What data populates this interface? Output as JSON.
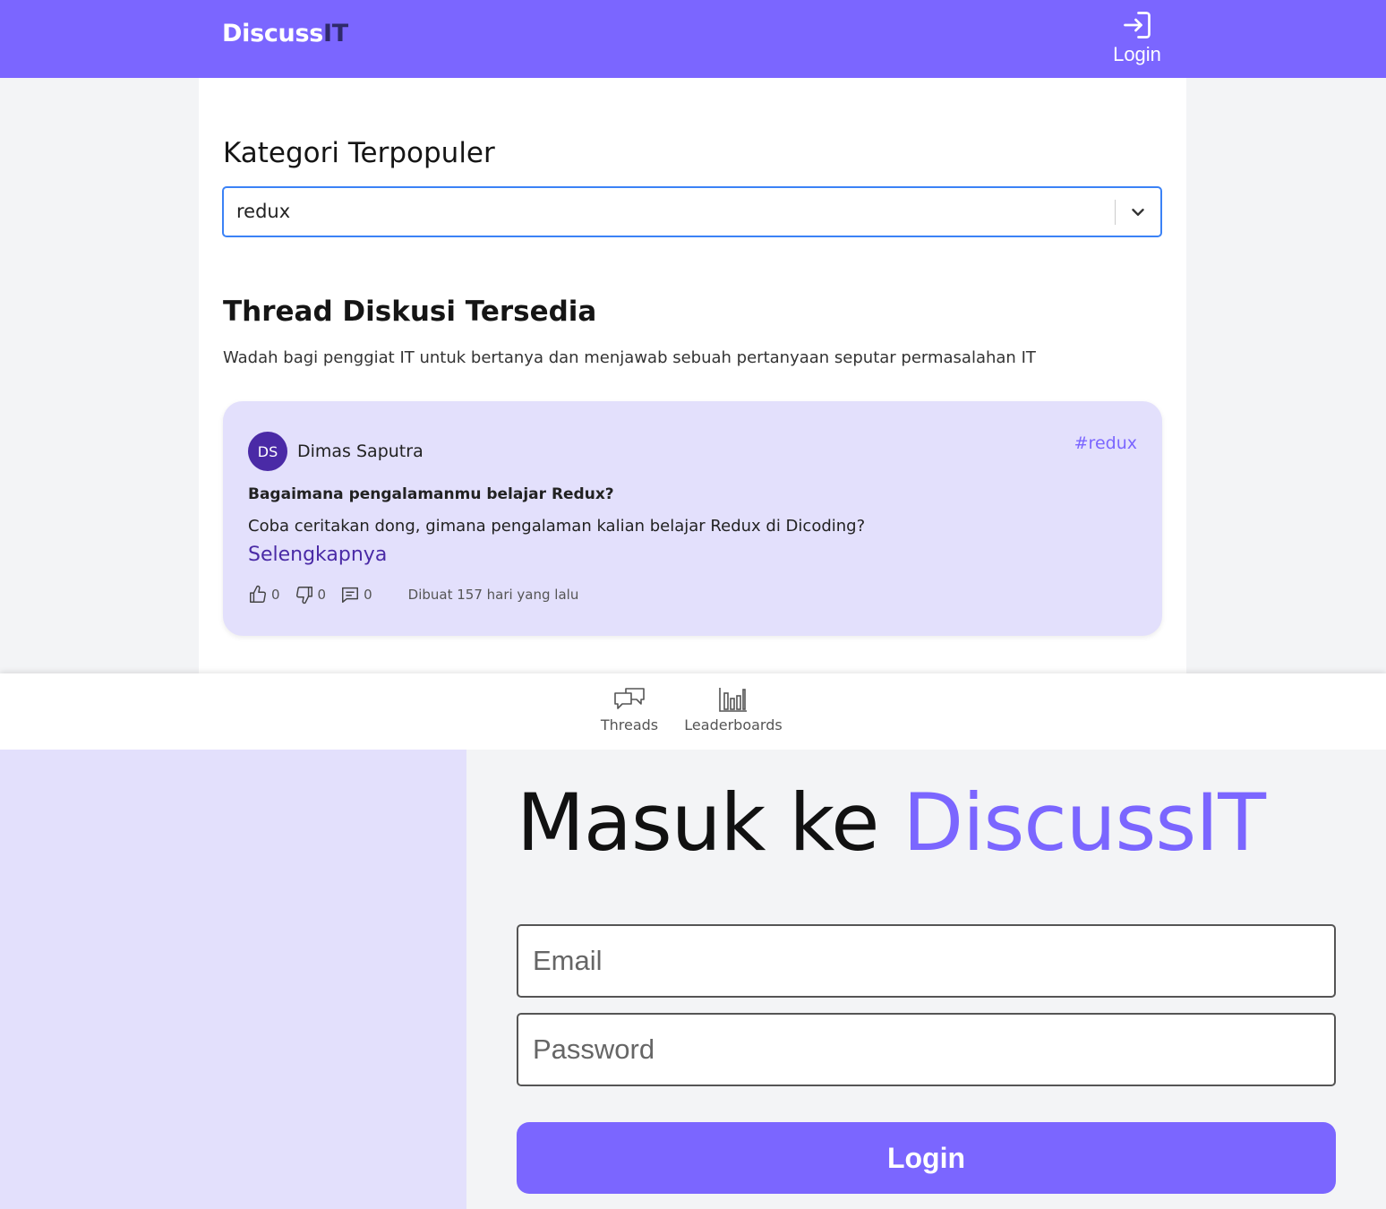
{
  "header": {
    "brand_main": "Discuss",
    "brand_accent": "IT",
    "login_label": "Login"
  },
  "categories": {
    "heading": "Kategori Terpopuler",
    "selected": "redux"
  },
  "threads": {
    "heading": "Thread Diskusi Tersedia",
    "description": "Wadah bagi penggiat IT untuk bertanya dan menjawab sebuah pertanyaan seputar permasalahan IT",
    "items": [
      {
        "avatar_initials": "DS",
        "author": "Dimas Saputra",
        "category": "#redux",
        "title": "Bagaimana pengalamanmu belajar Redux?",
        "body": "Coba ceritakan dong, gimana pengalaman kalian belajar Redux di Dicoding?",
        "read_more": "Selengkapnya",
        "upvotes": "0",
        "downvotes": "0",
        "comments": "0",
        "created": "Dibuat 157 hari yang lalu"
      }
    ]
  },
  "bottom_nav": {
    "threads_label": "Threads",
    "leaderboards_label": "Leaderboards"
  },
  "login": {
    "title_main": "Masuk ke ",
    "title_accent": "DiscussIT",
    "email_placeholder": "Email",
    "password_placeholder": "Password",
    "button_label": "Login"
  },
  "colors": {
    "primary": "#7b66ff",
    "card_bg": "#e3e0fc",
    "avatar_bg": "#4a2aa6",
    "focus_border": "#3b82f6"
  },
  "icons": {
    "login": "login-icon",
    "chevron": "chevron-down-icon",
    "upvote": "thumbs-up-icon",
    "downvote": "thumbs-down-icon",
    "comment": "comment-icon",
    "threads": "chat-bubbles-icon",
    "leaderboards": "bar-chart-icon"
  }
}
